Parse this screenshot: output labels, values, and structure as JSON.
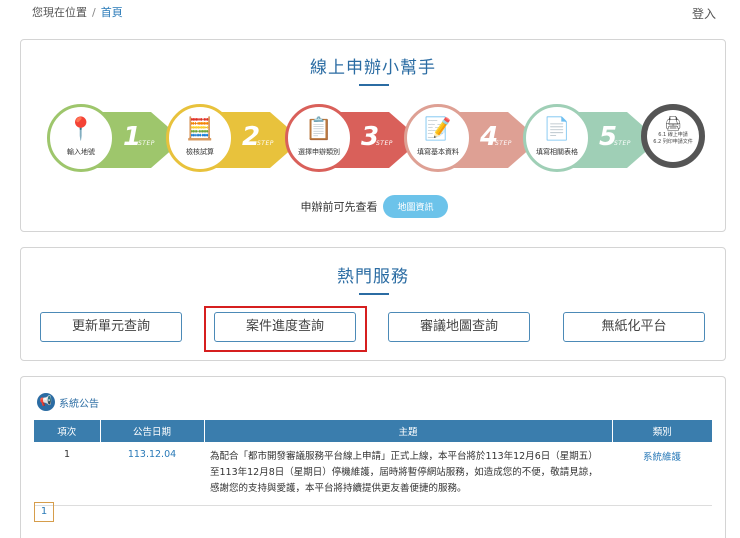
{
  "breadcrumb": {
    "prefix": "您現在位置",
    "separator": "/",
    "home": "首頁"
  },
  "header": {
    "login": "登入"
  },
  "helper": {
    "title": "線上申辦小幫手",
    "steps": [
      {
        "label": "輸入地號",
        "number": "1",
        "step_text": "STEP",
        "color": "#9ec66c",
        "icon": "map-pin-icon"
      },
      {
        "label": "檢核試算",
        "number": "2",
        "step_text": "STEP",
        "color": "#e8c23c",
        "icon": "calculator-icon"
      },
      {
        "label": "選擇申辦類別",
        "number": "3",
        "step_text": "STEP",
        "color": "#d9605a",
        "icon": "checklist-icon"
      },
      {
        "label": "填寫基本資料",
        "number": "4",
        "step_text": "STEP",
        "color": "#dea094",
        "icon": "clipboard-icon"
      },
      {
        "label": "填寫相關表格",
        "number": "5",
        "step_text": "STEP",
        "color": "#9fcfb6",
        "icon": "form-icon"
      }
    ],
    "final_step": {
      "line1": "6.1 線上申請",
      "line2": "6.2 列印申請文件",
      "icon": "printer-icon"
    },
    "pre_check_text": "申辦前可先查看",
    "map_button": "地圖資訊"
  },
  "hot_services": {
    "title": "熱門服務",
    "items": [
      "更新單元查詢",
      "案件進度查詢",
      "審議地圖查詢",
      "無紙化平台"
    ]
  },
  "announcements": {
    "title": "系統公告",
    "icon": "megaphone-icon",
    "columns": [
      "項次",
      "公告日期",
      "主題",
      "類別"
    ],
    "rows": [
      {
        "no": "1",
        "date": "113.12.04",
        "subject": "為配合「都市開發審議服務平台線上申請」正式上線，本平台將於113年12月6日（星期五）至113年12月8日（星期日）停機維護，屆時將暫停網站服務，如造成您的不便，敬請見諒，感謝您的支持與愛護，本平台將持續提供更友善便捷的服務。",
        "category": "系統維護"
      }
    ],
    "page": "1"
  }
}
